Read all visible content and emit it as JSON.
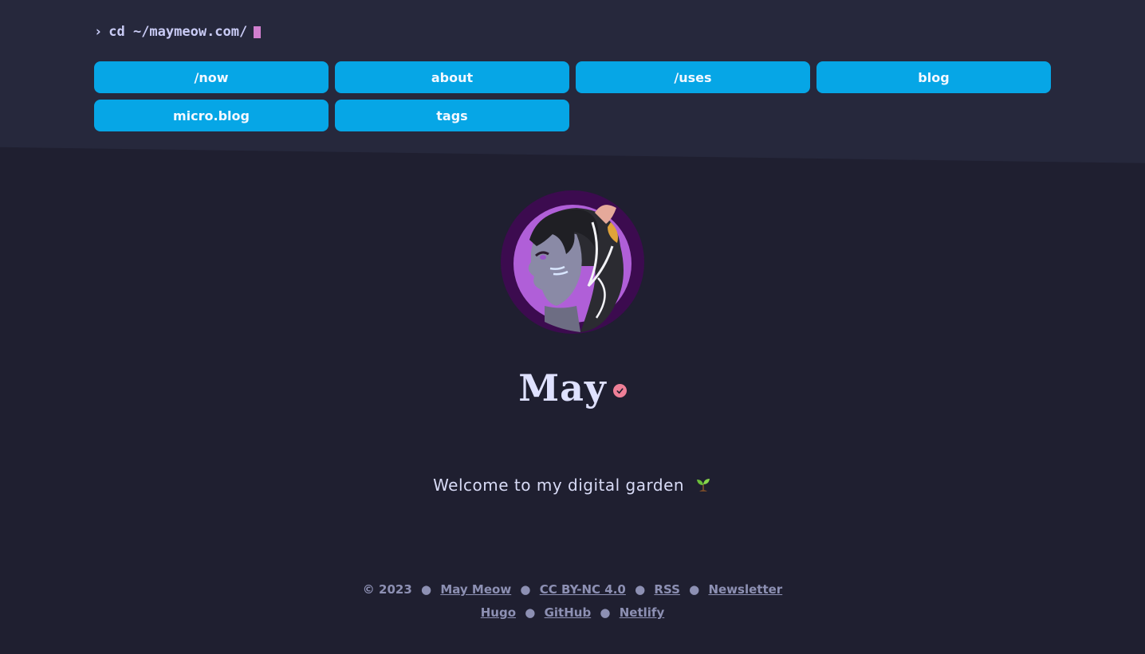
{
  "prompt": {
    "chevron": "›",
    "command": "cd ~/maymeow.com/"
  },
  "nav": [
    {
      "label": "/now"
    },
    {
      "label": "about"
    },
    {
      "label": "/uses"
    },
    {
      "label": "blog"
    },
    {
      "label": "micro.blog"
    },
    {
      "label": "tags"
    }
  ],
  "profile": {
    "name": "May",
    "tagline": "Welcome to my digital garden",
    "avatar_icon": "anime-cat-girl-avatar",
    "verified_icon": "check-badge-icon"
  },
  "footer": {
    "copyright": "© 2023",
    "separator": "●",
    "line1": [
      "May Meow",
      "CC BY-NC 4.0",
      "RSS",
      "Newsletter"
    ],
    "line2": [
      "Hugo",
      "GitHub",
      "Netlify"
    ]
  },
  "colors": {
    "background": "#1f1f30",
    "header": "#26283c",
    "button": "#06a6e6",
    "cursor": "#d17fcf",
    "badge": "#ee7f97"
  }
}
